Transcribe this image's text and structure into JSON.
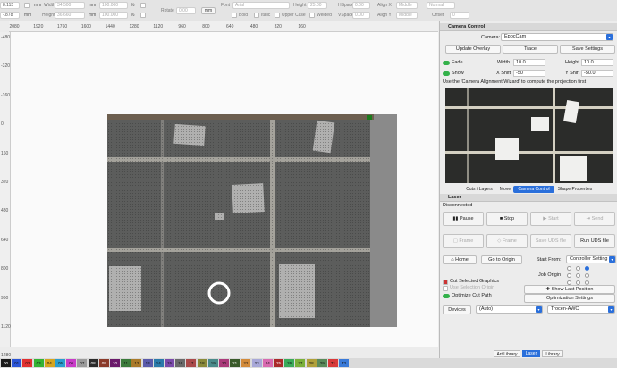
{
  "toolbar": {
    "x_value": "8.115",
    "y_value": "-.878",
    "unit_mm": "mm",
    "width_label": "Width",
    "width_value": "34.500",
    "height_label": "Height",
    "height_value": "36.660",
    "width_unit": "mm",
    "height_unit": "mm",
    "pct1": "100.000",
    "pct2": "100.000",
    "pct_sign": "%",
    "rotate_label": "Rotate",
    "rotate_value": "0.00",
    "rotate_unit": "mm",
    "font_label": "Font",
    "font_value": "Arial",
    "height2_label": "Height",
    "height2_value": "25.00",
    "hspace_label": "HSpace",
    "hspace_value": "0.00",
    "align_x_label": "Align X",
    "align_x_value": "Middle",
    "normal_value": "Normal",
    "bold_label": "Bold",
    "italic_label": "Italic",
    "upper_label": "Upper Case",
    "welded_label": "Welded",
    "vspace_label": "VSpace",
    "vspace_value": "0.00",
    "align_y_label": "Align Y",
    "align_y_value": "Middle",
    "offset_label": "Offset",
    "offset_value": "0"
  },
  "ruler_top": [
    "2080",
    "1920",
    "1760",
    "1600",
    "1440",
    "1280",
    "1120",
    "960",
    "800",
    "640",
    "480",
    "320",
    "160"
  ],
  "ruler_left": [
    "-480",
    "-320",
    "-160",
    "0",
    "160",
    "320",
    "480",
    "640",
    "800",
    "960",
    "1120",
    "1280"
  ],
  "palette": [
    "00",
    "01",
    "02",
    "03",
    "04",
    "05",
    "06",
    "07",
    "08",
    "09",
    "10",
    "11",
    "12",
    "13",
    "14",
    "15",
    "16",
    "17",
    "18",
    "19",
    "20",
    "21",
    "22",
    "23",
    "24",
    "25",
    "26",
    "27",
    "28",
    "29",
    "T1",
    "T2"
  ],
  "palette_colors": [
    "#1a1a1a",
    "#2b55d6",
    "#e03030",
    "#34b334",
    "#d6a51f",
    "#2a9dcf",
    "#c83cc8",
    "#9b9b9b",
    "#2b2b2b",
    "#8a3a2a",
    "#6a1a6a",
    "#3a7a3a",
    "#aa7a2a",
    "#5a5aaa",
    "#2a7aaa",
    "#7a4aaa",
    "#6a6a6a",
    "#aa4a4a",
    "#8a8a3a",
    "#4a8a8a",
    "#aa3a7a",
    "#3a5a2a",
    "#d28a3a",
    "#a8a8d8",
    "#d86ab0",
    "#aa2a2a",
    "#3aaa5a",
    "#7ab03a",
    "#b0a03a",
    "#5a8a5a",
    "#d83a3a",
    "#3a7ad8"
  ],
  "camera": {
    "title": "Camera Control",
    "camera_label": "Camera:",
    "camera_value": "EpocCam",
    "update_overlay": "Update Overlay",
    "trace": "Trace",
    "save_settings": "Save Settings",
    "fade_label": "Fade",
    "show_label": "Show",
    "width_label": "Width",
    "width_value": "10.0",
    "height_label": "Height",
    "height_value": "10.0",
    "xshift_label": "X Shift",
    "xshift_value": "-50",
    "yshift_label": "Y Shift",
    "yshift_value": "-50.0",
    "hint": "Use the 'Camera Alignment Wizard' to compute the projection first"
  },
  "tabs": [
    "Cuts / Layers",
    "Move",
    "Camera Control",
    "Shape Properties"
  ],
  "laser": {
    "title": "Laser",
    "status": "Disconnected",
    "pause": "Pause",
    "stop": "Stop",
    "start": "Start",
    "send": "Send",
    "frame1": "Frame",
    "frame2": "Frame",
    "save_uds": "Save UDS file",
    "run_uds": "Run UDS file",
    "home": "Home",
    "go_origin": "Go to Origin",
    "start_from_label": "Start From:",
    "start_from_value": "Controller Setting",
    "job_origin_label": "Job Origin",
    "cut_selected": "Cut Selected Graphics",
    "use_selection_origin": "Use Selection Origin",
    "optimize_cut": "Optimize Cut Path",
    "show_last_position": "Show Last Position",
    "optimization_settings": "Optimization Settings",
    "devices_label": "Devices",
    "devices_value": "(Auto)",
    "device_name": "Trocen-AWC"
  },
  "bottom_tabs": [
    "Art Library",
    "Laser",
    "Library"
  ]
}
